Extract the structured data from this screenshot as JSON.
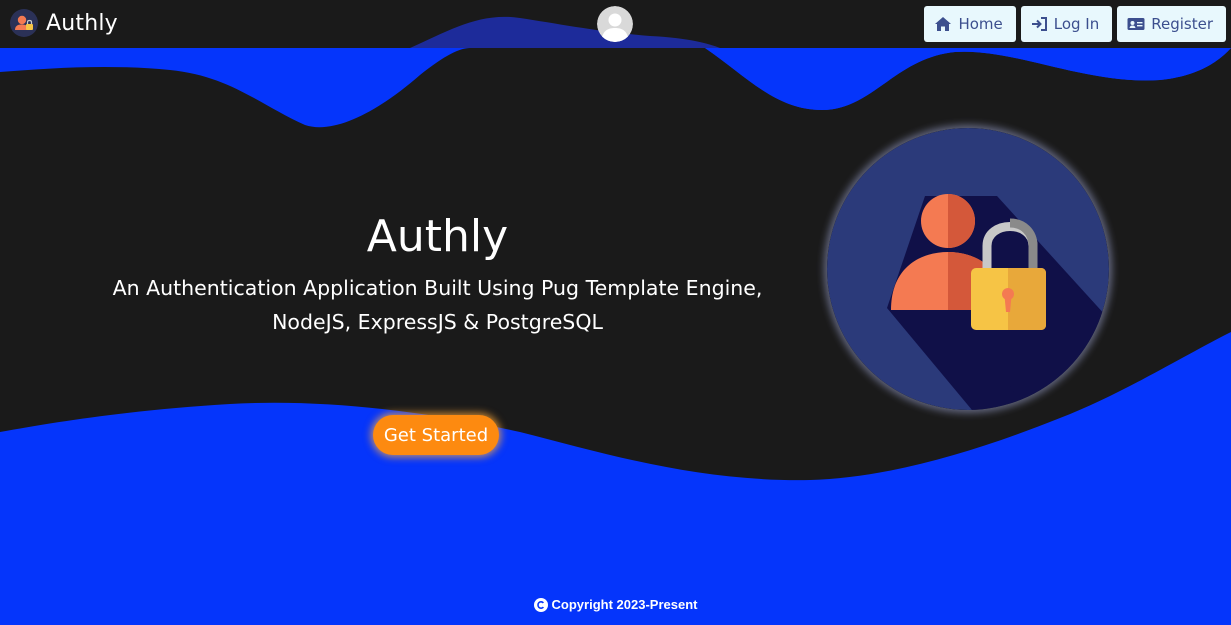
{
  "app": {
    "brand_name": "Authly",
    "logo_icon": "user-lock-icon"
  },
  "nav": {
    "avatar_icon": "user-avatar-icon",
    "buttons": [
      {
        "label": "Home",
        "icon": "home-icon"
      },
      {
        "label": "Log In",
        "icon": "login-icon"
      },
      {
        "label": "Register",
        "icon": "id-card-icon"
      }
    ]
  },
  "hero": {
    "title": "Authly",
    "subtitle": "An Authentication Application Built Using Pug Template Engine, NodeJS, ExpressJS & PostgreSQL",
    "cta_label": "Get Started",
    "illustration": "user-with-padlock-illustration"
  },
  "footer": {
    "copyright_icon": "copyright-icon",
    "text": "Copyright 2023-Present"
  },
  "colors": {
    "background_blue": "#0535fb",
    "hero_dark": "#1a1a1a",
    "cta_orange": "#fd8a10",
    "nav_button_bg": "#e8f8fd",
    "nav_button_text": "#3c4f8e"
  }
}
